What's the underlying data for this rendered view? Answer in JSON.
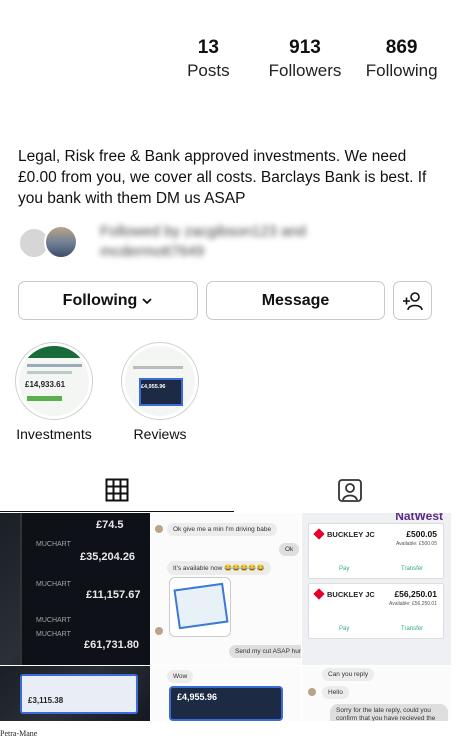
{
  "profile": {
    "stats": [
      {
        "value": "13",
        "label": "Posts"
      },
      {
        "value": "913",
        "label": "Followers"
      },
      {
        "value": "869",
        "label": "Following"
      }
    ],
    "bio": "Legal, Risk free & Bank approved investments. We need £0.00 from you, we cover all costs. Barclays Bank is best. If you bank with them DM us ASAP",
    "followed_by": "Followed by zacgibson123 and mcdermott7649"
  },
  "buttons": {
    "following": "Following",
    "message": "Message"
  },
  "highlights": [
    {
      "label": "Investments",
      "thumb_amount": "£14,933.61"
    },
    {
      "label": "Reviews",
      "thumb_amount": "£4,955.96"
    }
  ],
  "tabs": [
    {
      "icon": "grid-icon"
    },
    {
      "icon": "tagged-icon"
    }
  ],
  "posts": {
    "post1": {
      "amounts": [
        "£74.5",
        "£35,204.26",
        "£11,157.67",
        "£61,731.80"
      ],
      "accounts": [
        "MUCHART",
        "MUCHART",
        "MUCHART",
        "MUCHART"
      ]
    },
    "post2": {
      "messages": [
        "Ok give me a min I'm driving babe",
        "Ok",
        "It's available now 😂😂😂😂😂",
        "Send my cut ASAP hun"
      ]
    },
    "post3": {
      "bank": "NatWest",
      "cards": [
        {
          "name": "BUCKLEY JC",
          "amount": "£500.05",
          "available": "Available: £500.05",
          "pay": "Pay",
          "transfer": "Transfer"
        },
        {
          "name": "BUCKLEY JC",
          "amount": "£56,250.01",
          "available": "Available: £56,250.01",
          "pay": "Pay",
          "transfer": "Transfer"
        }
      ]
    },
    "post4": {
      "amount": "£3,115.38"
    },
    "post5": {
      "tag": "Wow",
      "amount": "£4,955.96"
    },
    "post6": {
      "messages": [
        "Can you reply",
        "Hello",
        "Sorry for the late reply, could you confirm that you have recieved the"
      ]
    }
  },
  "caption": "Petra-Mane",
  "colors": {
    "natwest_red": "#e4002b",
    "positive_green": "#33aa77"
  }
}
